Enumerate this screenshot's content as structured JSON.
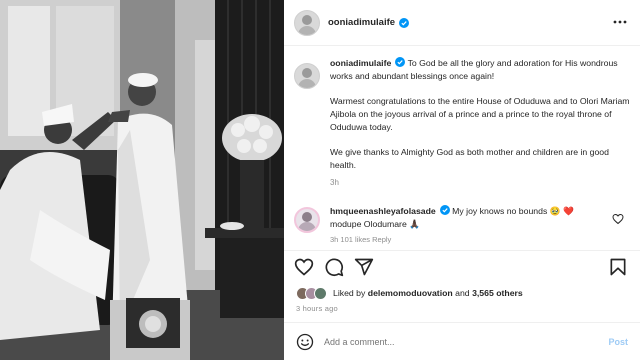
{
  "header": {
    "username": "ooniadimulaife",
    "verified": true,
    "more_icon": "more-horizontal-icon"
  },
  "caption": {
    "username": "ooniadimulaife",
    "paragraphs": [
      "To God be all the glory and adoration for His wondrous works and abundant blessings once again!",
      "Warmest congratulations to the entire House of Oduduwa and to Olori Mariam Ajibola on the joyous arrival of a prince and a prince to the royal throne of Oduduwa today.",
      "We give thanks to Almighty God as both mother and children are in good health."
    ],
    "time": "3h"
  },
  "comment": {
    "username": "hmqueenashleyafolasade",
    "text": "My joy knows no bounds 🥹 ❤️ modupe Olodumare 🙏🏿",
    "meta": "3h   101 likes   Reply"
  },
  "actions": {
    "icons": [
      "heart-icon",
      "comment-icon",
      "share-icon",
      "bookmark-icon"
    ]
  },
  "likes": {
    "prefix": "Liked by ",
    "user": "delemomoduovation",
    "middle": " and ",
    "count": "3,565 others"
  },
  "posted": "3 hours ago",
  "add_comment": {
    "placeholder": "Add a comment...",
    "post_label": "Post"
  },
  "colors": {
    "verified_blue": "#0095f6",
    "post_button": "#9ecbf5",
    "secondary_text": "#8e8e8e"
  }
}
